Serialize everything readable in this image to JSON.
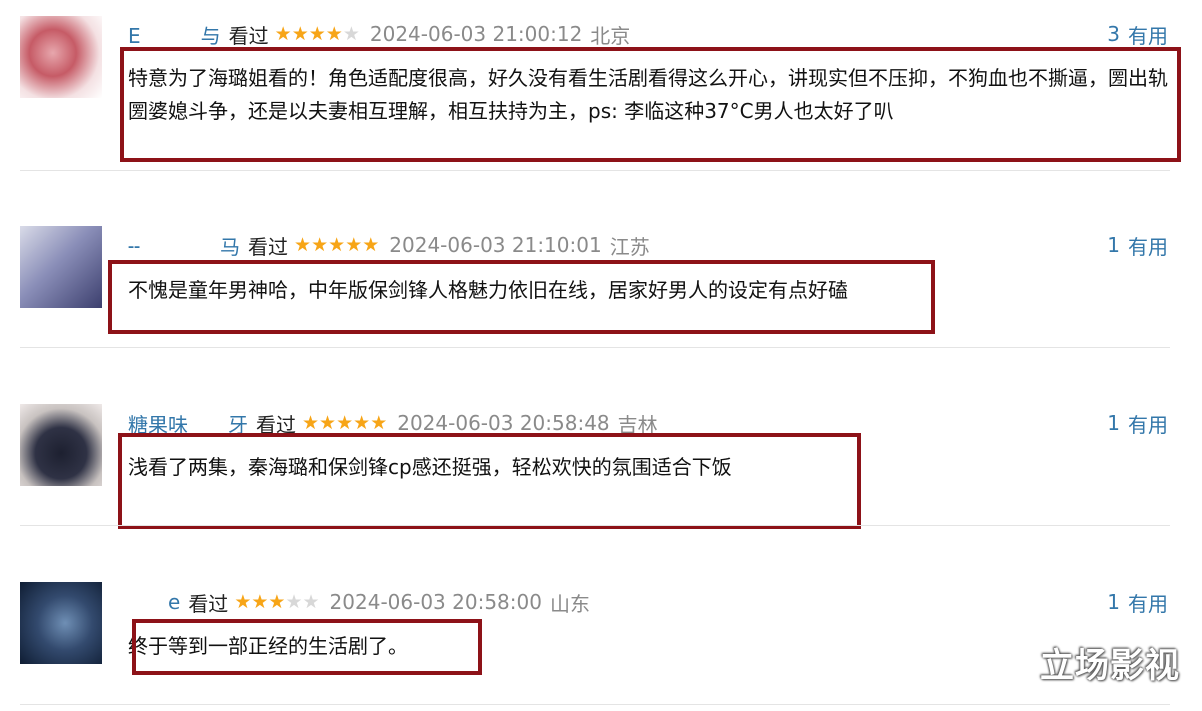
{
  "reviews": [
    {
      "username": "Е   与",
      "watched": "看过",
      "rating": 4,
      "time": "2024-06-03 21:00:12",
      "location": "北京",
      "useful_count": "3",
      "useful_label": "有用",
      "content": "特意为了海璐姐看的！角色适配度很高，好久没有看生活剧看得这么开心，讲现实但不压抑，不狗血也不撕逼，圐出轨圐婆媳斗争，还是以夫妻相互理解，相互扶持为主，ps: 李临这种37°C男人也太好了叭"
    },
    {
      "username": "╌    马",
      "watched": "看过",
      "rating": 5,
      "time": "2024-06-03 21:10:01",
      "location": "江苏",
      "useful_count": "1",
      "useful_label": "有用",
      "content": "不愧是童年男神哈，中年版保剑锋人格魅力依旧在线，居家好男人的设定有点好磕"
    },
    {
      "username": "糖果味  牙",
      "watched": "看过",
      "rating": 5,
      "time": "2024-06-03 20:58:48",
      "location": "吉林",
      "useful_count": "1",
      "useful_label": "有用",
      "content": "浅看了两集，秦海璐和保剑锋cp感还挺强，轻松欢快的氛围适合下饭"
    },
    {
      "username": "  e",
      "watched": "看过",
      "rating": 3,
      "time": "2024-06-03 20:58:00",
      "location": "山东",
      "useful_count": "1",
      "useful_label": "有用",
      "content": "终于等到一部正经的生活剧了。"
    }
  ],
  "watermark": "立场影视",
  "colors": {
    "star": "#f7a517",
    "link": "#3377aa",
    "highlight_box": "#8d1218"
  }
}
